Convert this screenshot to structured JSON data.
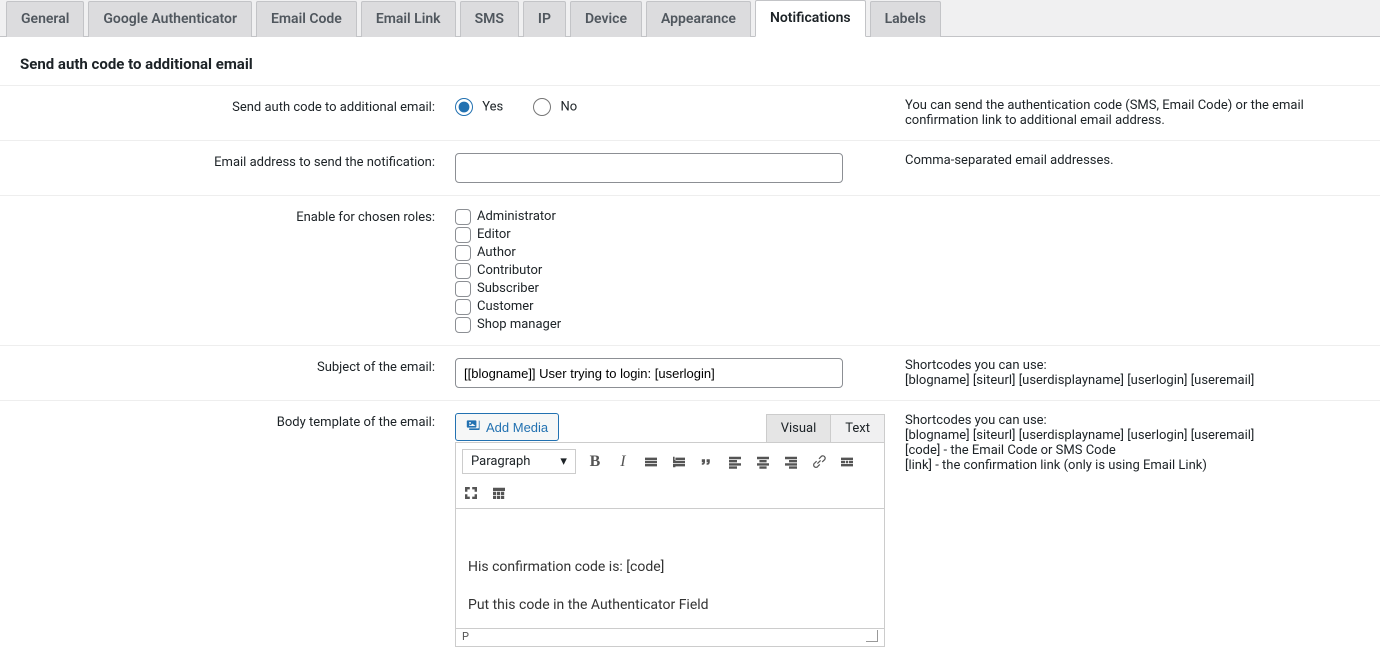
{
  "tabs": [
    {
      "label": "General"
    },
    {
      "label": "Google Authenticator"
    },
    {
      "label": "Email Code"
    },
    {
      "label": "Email Link"
    },
    {
      "label": "SMS"
    },
    {
      "label": "IP"
    },
    {
      "label": "Device"
    },
    {
      "label": "Appearance"
    },
    {
      "label": "Notifications",
      "active": true
    },
    {
      "label": "Labels"
    }
  ],
  "section_heading": "Send auth code to additional email",
  "rows": {
    "send_email": {
      "label": "Send auth code to additional email:",
      "yes": "Yes",
      "no": "No",
      "help": "You can send the authentication code (SMS, Email Code) or the email confirmation link to additional email address."
    },
    "email_address": {
      "label": "Email address to send the notification:",
      "value": "",
      "help": "Comma-separated email addresses."
    },
    "roles": {
      "label": "Enable for chosen roles:",
      "items": [
        "Administrator",
        "Editor",
        "Author",
        "Contributor",
        "Subscriber",
        "Customer",
        "Shop manager"
      ]
    },
    "subject": {
      "label": "Subject of the email:",
      "value": "[[blogname]] User trying to login: [userlogin]",
      "help": "Shortcodes you can use:\n[blogname] [siteurl] [userdisplayname] [userlogin] [useremail]"
    },
    "body": {
      "label": "Body template of the email:",
      "add_media": "Add Media",
      "tab_visual": "Visual",
      "tab_text": "Text",
      "format": "Paragraph",
      "content_line1": "His confirmation code is: [code]",
      "content_line2": "Put this code in the Authenticator Field",
      "status_path": "P",
      "help": "Shortcodes you can use:\n[blogname] [siteurl] [userdisplayname] [userlogin] [useremail]\n[code] - the Email Code or SMS Code\n[link] - the confirmation link (only is using Email Link)"
    }
  }
}
